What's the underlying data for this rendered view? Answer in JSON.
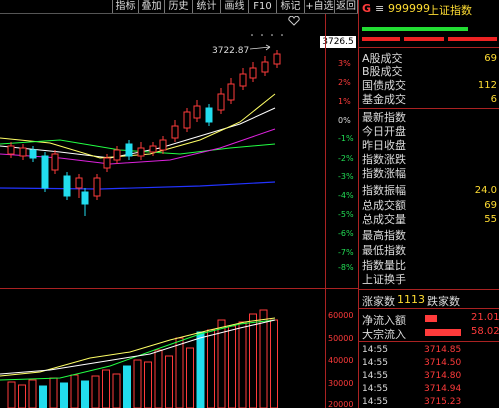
{
  "toolbar": {
    "buttons": [
      "指标",
      "叠加",
      "历史",
      "统计",
      "画线",
      "F10",
      "标记",
      "+自选",
      "返回"
    ]
  },
  "chart": {
    "current_price_box": "3726.5",
    "peak_label": "3722.87",
    "pct_labels": [
      "3%",
      "2%",
      "1%",
      "0%",
      "-1%",
      "-2%",
      "-3%",
      "-4%",
      "-5%",
      "-6%",
      "-7%",
      "-8%"
    ],
    "volume_labels": [
      "60000",
      "50000",
      "40000",
      "30000",
      "20000"
    ]
  },
  "right_panel": {
    "g": "G",
    "menu": "≡",
    "code": "999999",
    "name": "上证指数",
    "stats": [
      {
        "label": "A股成交",
        "value": "69"
      },
      {
        "label": "B股成交",
        "value": ""
      },
      {
        "label": "国债成交",
        "value": "112"
      },
      {
        "label": "基金成交",
        "value": "6"
      },
      {
        "label": "最新指数",
        "value": ""
      },
      {
        "label": "今日开盘",
        "value": ""
      },
      {
        "label": "昨日收盘",
        "value": ""
      },
      {
        "label": "指数涨跌",
        "value": ""
      },
      {
        "label": "指数涨幅",
        "value": ""
      },
      {
        "label": "指数振幅",
        "value": "24.0"
      },
      {
        "label": "总成交额",
        "value": "69"
      },
      {
        "label": "总成交量",
        "value": "55"
      },
      {
        "label": "最高指数",
        "value": ""
      },
      {
        "label": "最低指数",
        "value": ""
      },
      {
        "label": "指数量比",
        "value": ""
      },
      {
        "label": "上证换手",
        "value": ""
      }
    ],
    "updown": {
      "up_label": "涨家数",
      "up_value": "1113",
      "down_label": "跌家数",
      "down_value": ""
    },
    "flows": [
      {
        "label": "净流入额",
        "value": "21.01"
      },
      {
        "label": "大宗流入",
        "value": "58.02"
      }
    ],
    "ticks": [
      {
        "time": "14:55",
        "price": "3714.85"
      },
      {
        "time": "14:55",
        "price": "3714.50"
      },
      {
        "time": "14:55",
        "price": "3714.80"
      },
      {
        "time": "14:55",
        "price": "3714.94"
      },
      {
        "time": "14:55",
        "price": "3715.23"
      }
    ]
  }
}
